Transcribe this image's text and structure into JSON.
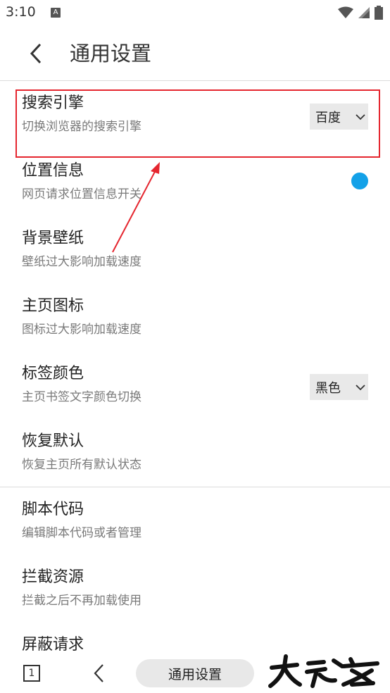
{
  "status_bar": {
    "time": "3:10",
    "app_icon_letter": "A"
  },
  "header": {
    "title": "通用设置",
    "back_icon": "chevron-left-icon"
  },
  "settings": [
    {
      "title": "搜索引擎",
      "desc": "切换浏览器的搜索引擎",
      "control": "select",
      "value": "百度"
    },
    {
      "title": "位置信息",
      "desc": "网页请求位置信息开关",
      "control": "toggle",
      "state": "on",
      "color": "#13a1e8"
    },
    {
      "title": "背景壁纸",
      "desc": "壁纸过大影响加载速度",
      "control": "none"
    },
    {
      "title": "主页图标",
      "desc": "图标过大影响加载速度",
      "control": "none"
    },
    {
      "title": "标签颜色",
      "desc": "主页书签文字颜色切换",
      "control": "select",
      "value": "黑色"
    },
    {
      "title": "恢复默认",
      "desc": "恢复主页所有默认状态",
      "control": "none"
    }
  ],
  "settings_more": [
    {
      "title": "脚本代码",
      "desc": "编辑脚本代码或者管理"
    },
    {
      "title": "拦截资源",
      "desc": "拦截之后不再加载使用"
    },
    {
      "title": "屏蔽请求",
      "desc": ""
    }
  ],
  "annotation": {
    "highlight_color": "#e5262f"
  },
  "bottom_bar": {
    "tab_count": "1",
    "title": "通用设置"
  },
  "watermark": {
    "text": "大玩客"
  }
}
